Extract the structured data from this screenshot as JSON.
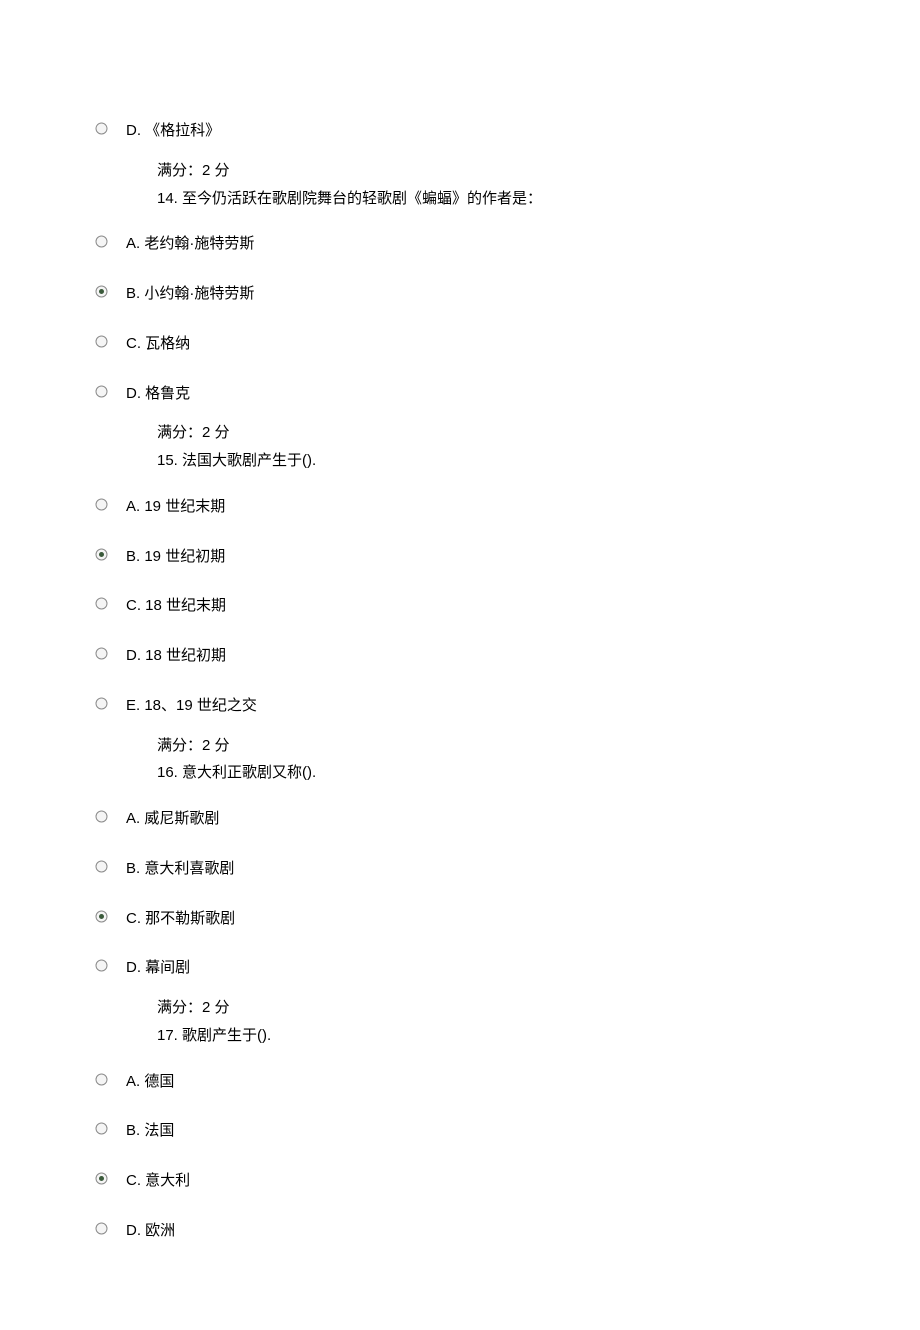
{
  "q13_remainder": {
    "optionD": "D. 《格拉科》",
    "score": "满分：2 分"
  },
  "q14": {
    "prompt": "14. 至今仍活跃在歌剧院舞台的轻歌剧《蝙蝠》的作者是：",
    "A": "A. 老约翰·施特劳斯",
    "B": "B. 小约翰·施特劳斯",
    "C": "C. 瓦格纳",
    "D": "D. 格鲁克",
    "score": "满分：2 分",
    "selected": "B"
  },
  "q15": {
    "prompt": "15. 法国大歌剧产生于().",
    "A": "A. 19 世纪末期",
    "B": "B. 19 世纪初期",
    "C": "C. 18 世纪末期",
    "D": "D. 18 世纪初期",
    "E": "E. 18、19 世纪之交",
    "score": "满分：2 分",
    "selected": "B"
  },
  "q16": {
    "prompt": "16. 意大利正歌剧又称().",
    "A": "A. 威尼斯歌剧",
    "B": "B. 意大利喜歌剧",
    "C": "C. 那不勒斯歌剧",
    "D": "D. 幕间剧",
    "score": "满分：2 分",
    "selected": "C"
  },
  "q17": {
    "prompt": "17. 歌剧产生于().",
    "A": "A. 德国",
    "B": "B. 法国",
    "C": "C. 意大利",
    "D": "D. 欧洲",
    "selected": "C"
  }
}
